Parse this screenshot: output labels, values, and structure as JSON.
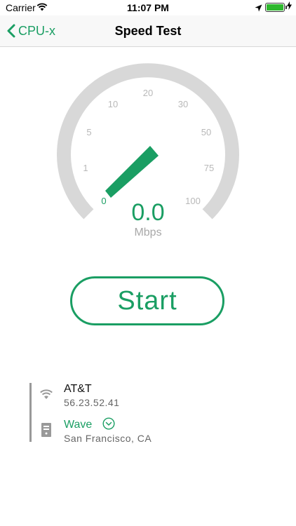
{
  "status_bar": {
    "carrier": "Carrier",
    "time": "11:07 PM"
  },
  "nav": {
    "back_label": "CPU-x",
    "title": "Speed Test"
  },
  "gauge": {
    "tick_labels": [
      "0",
      "1",
      "5",
      "10",
      "20",
      "30",
      "50",
      "75",
      "100"
    ],
    "needle_value": 0.0,
    "track_color": "#d8d8d8",
    "accent_color": "#1a9e63"
  },
  "readout": {
    "value": "0.0",
    "unit": "Mbps"
  },
  "start_button": {
    "label": "Start"
  },
  "connection": {
    "isp": "AT&T",
    "ip": "56.23.52.41",
    "server_name": "Wave",
    "server_location": "San Francisco, CA"
  },
  "icons": {
    "back": "chevron-left-icon",
    "wifi": "wifi-icon",
    "server": "server-icon",
    "dropdown": "chevron-down-circle-icon",
    "location": "location-arrow-icon",
    "battery": "battery-icon"
  }
}
